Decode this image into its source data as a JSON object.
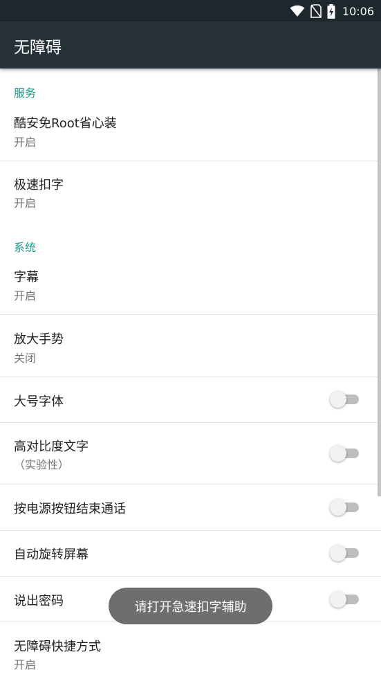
{
  "status_bar": {
    "time": "10:06",
    "icons": [
      "wifi-icon",
      "no-sim-icon",
      "battery-charging-icon"
    ]
  },
  "toolbar": {
    "title": "无障碍"
  },
  "sections": {
    "services": {
      "header": "服务",
      "items": [
        {
          "title": "酷安免Root省心装",
          "summary": "开启"
        },
        {
          "title": "极速扣字",
          "summary": "开启"
        }
      ]
    },
    "system": {
      "header": "系统",
      "items": [
        {
          "title": "字幕",
          "summary": "开启"
        },
        {
          "title": "放大手势",
          "summary": "关闭"
        },
        {
          "title": "大号字体",
          "switch_on": false
        },
        {
          "title": "高对比度文字",
          "summary": "（实验性）",
          "switch_on": false
        },
        {
          "title": "按电源按钮结束通话",
          "switch_on": false
        },
        {
          "title": "自动旋转屏幕",
          "switch_on": false
        },
        {
          "title": "说出密码",
          "switch_on": false
        },
        {
          "title": "无障碍快捷方式",
          "summary": "开启"
        }
      ]
    }
  },
  "toast": {
    "text": "请打开急速扣字辅助"
  },
  "colors": {
    "toolbar": "#263238",
    "status_bar": "#1d272c",
    "section_header": "#1a9a8a",
    "toast_bg": "#6e6e6e"
  }
}
